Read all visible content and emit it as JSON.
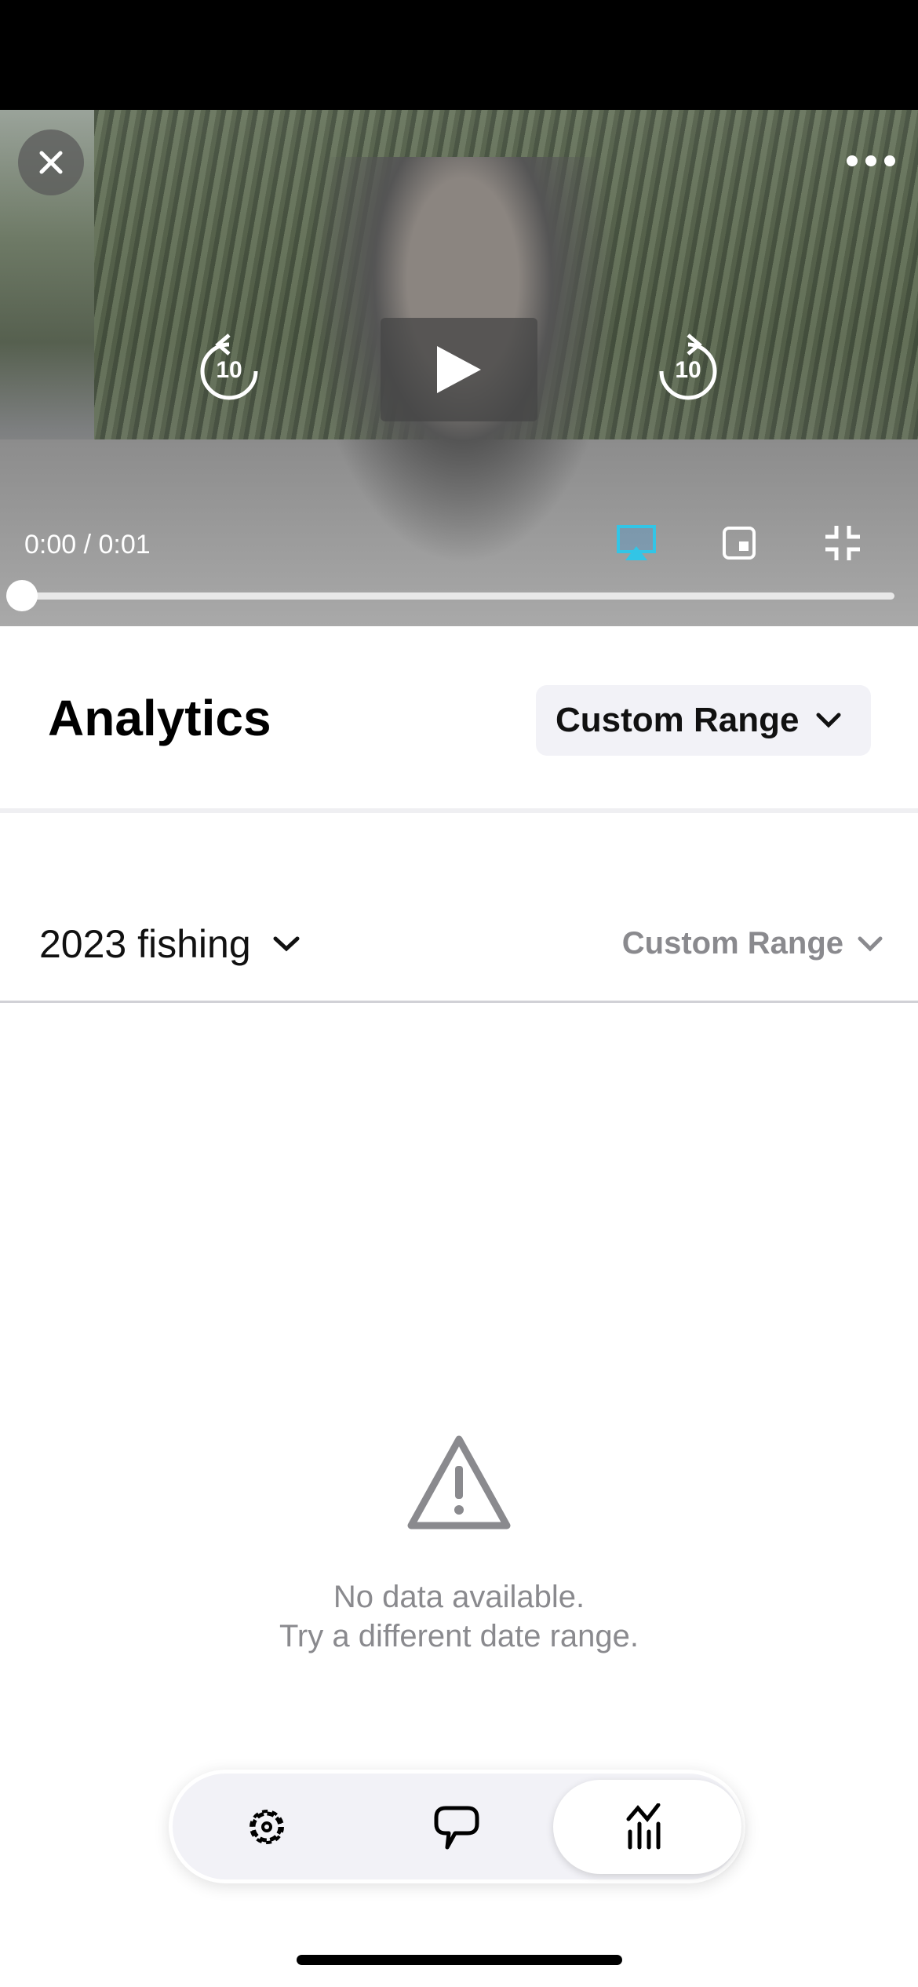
{
  "video": {
    "time": "0:00 / 0:01",
    "progress": 0,
    "skip_seconds": "10",
    "airplay_color": "#32c5e6"
  },
  "header": {
    "title": "Analytics",
    "range_button": "Custom Range"
  },
  "filter": {
    "dataset": "2023 fishing",
    "range": "Custom Range"
  },
  "empty_state": {
    "line1": "No data available.",
    "line2": "Try a different date range."
  },
  "tabbar": {
    "items": [
      {
        "icon": "gear-icon"
      },
      {
        "icon": "speech-bubble-icon"
      },
      {
        "icon": "analytics-chart-icon",
        "active": true
      }
    ]
  }
}
